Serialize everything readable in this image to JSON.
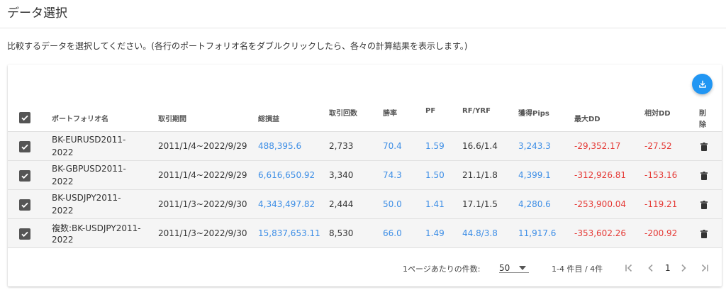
{
  "page": {
    "title": "データ選択",
    "description": "比較するデータを選択してください。(各行のポートフォリオ名をダブルクリックしたら、各々の計算結果を表示します。)"
  },
  "table": {
    "headers": {
      "name": "ポートフォリオ名",
      "period": "取引期間",
      "total_pl": "総損益",
      "trades": "取引回数",
      "win_rate": "勝率",
      "pf": "PF",
      "rf": "RF/YRF",
      "pips": "獲得Pips",
      "max_dd": "最大DD",
      "rel_dd": "相対DD",
      "delete_1": "削",
      "delete_2": "除"
    },
    "rows": [
      {
        "name_1": "BK-EURUSD2011-",
        "name_2": "2022",
        "period": "2011/1/4~2022/9/29",
        "total_pl": "488,395.6",
        "trades": "2,733",
        "win_rate": "70.4",
        "pf": "1.59",
        "rf": "16.6/1.4",
        "pips": "3,243.3",
        "max_dd": "-29,352.17",
        "rel_dd": "-27.52"
      },
      {
        "name_1": "BK-GBPUSD2011-",
        "name_2": "2022",
        "period": "2011/1/4~2022/9/29",
        "total_pl": "6,616,650.92",
        "trades": "3,340",
        "win_rate": "74.3",
        "pf": "1.50",
        "rf": "21.1/1.8",
        "pips": "4,399.1",
        "max_dd": "-312,926.81",
        "rel_dd": "-153.16"
      },
      {
        "name_1": "BK-USDJPY2011-",
        "name_2": "2022",
        "period": "2011/1/3~2022/9/30",
        "total_pl": "4,343,497.82",
        "trades": "2,444",
        "win_rate": "50.0",
        "pf": "1.41",
        "rf": "17.1/1.5",
        "pips": "4,280.6",
        "max_dd": "-253,900.04",
        "rel_dd": "-119.21"
      },
      {
        "name_1": "複数:BK-USDJPY2011-",
        "name_2": "2022",
        "period": "2011/1/3~2022/9/30",
        "total_pl": "15,837,653.11",
        "trades": "8,530",
        "win_rate": "66.0",
        "pf": "1.49",
        "rf": "44.8/3.8",
        "pips": "11,917.6",
        "max_dd": "-353,602.26",
        "rel_dd": "-200.92"
      }
    ]
  },
  "footer": {
    "per_page_label": "1ページあたりの件数:",
    "per_page_value": "50",
    "range_text": "1-4 件目 / 4件",
    "current_page": "1"
  },
  "colors": {
    "accent": "#2196f3",
    "link": "#3d8ee6",
    "negative": "#e53935",
    "checkbox": "#555555",
    "row_bg": "#f5f5f5"
  },
  "icons": [
    "download-icon",
    "checkbox-checked-icon",
    "trash-icon",
    "chevron-down-icon",
    "first-page-icon",
    "prev-page-icon",
    "next-page-icon",
    "last-page-icon"
  ]
}
